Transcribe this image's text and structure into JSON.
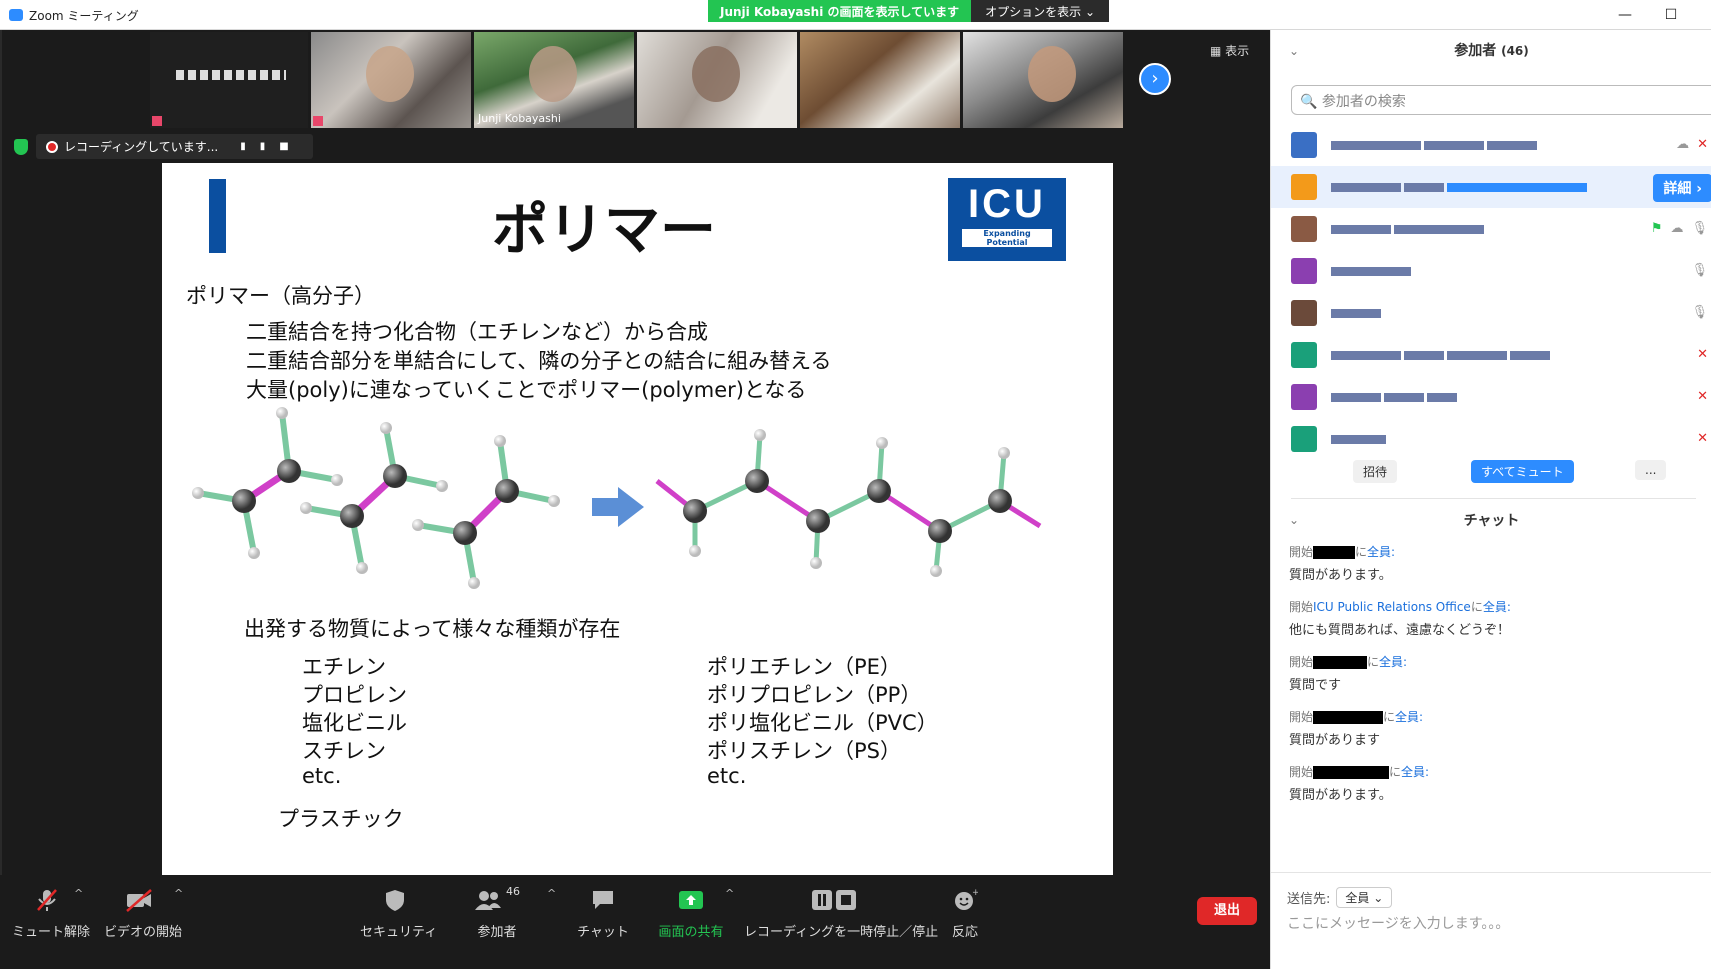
{
  "window": {
    "title": "Zoom ミーティング",
    "share_banner": "Junji  Kobayashi の画面を表示しています",
    "share_options": "オプションを表示 ⌄",
    "minimize": "—",
    "maximize": "☐"
  },
  "gallery": {
    "view_label": "表示",
    "named_participant": "Junji Kobayashi"
  },
  "recording": {
    "status": "レコーディングしています...",
    "pause_icon": "pause-icon",
    "stop_icon": "stop-icon"
  },
  "slide": {
    "title": "ポリマー",
    "logo_main": "ICU",
    "logo_sub": "Expanding Potential",
    "heading": "ポリマー（高分子）",
    "lines": [
      "二重結合を持つ化合物（エチレンなど）から合成",
      "二重結合部分を単結合にして、隣の分子との結合に組み替える",
      "大量(poly)に連なっていくことでポリマー(polymer)となる"
    ],
    "variety_heading": "出発する物質によって様々な種類が存在",
    "monomers": [
      "エチレン",
      "プロピレン",
      "塩化ビニル",
      "スチレン",
      "etc."
    ],
    "polymers": [
      "ポリエチレン（PE）",
      "ポリプロピレン（PP）",
      "ポリ塩化ビニル（PVC）",
      "ポリスチレン（PS）",
      "etc."
    ],
    "footer": "プラスチック"
  },
  "controls": {
    "unmute": "ミュート解除",
    "start_video": "ビデオの開始",
    "security": "セキュリティ",
    "participants": "参加者",
    "participants_count": "46",
    "chat": "チャット",
    "share": "画面の共有",
    "record": "レコーディングを一時停止／停止",
    "reactions": "反応",
    "leave": "退出"
  },
  "participants_panel": {
    "title": "参加者",
    "count": "(46)",
    "search_placeholder": "参加者の検索",
    "detail_button": "詳細 ›",
    "invite": "招待",
    "mute_all": "すべてミュート",
    "more": "..."
  },
  "chat_panel": {
    "title": "チャット",
    "messages": [
      {
        "prefix": "開始",
        "sender": "",
        "to_prefix": "に",
        "to": "全員:",
        "body": "質問があります。"
      },
      {
        "prefix": "開始",
        "sender": "ICU Public Relations Office",
        "to_prefix": "に",
        "to": "全員:",
        "body": "他にも質問あれば、遠慮なくどうぞ！"
      },
      {
        "prefix": "開始",
        "sender": "",
        "to_prefix": "に",
        "to": "全員:",
        "body": "質問です"
      },
      {
        "prefix": "開始",
        "sender": "",
        "to_prefix": "に",
        "to": "全員:",
        "body": "質問があります"
      },
      {
        "prefix": "開始",
        "sender": "",
        "to_prefix": "に",
        "to": "全員:",
        "body": "質問があります。"
      }
    ],
    "send_to_label": "送信先:",
    "send_to_value": "全員 ⌄",
    "input_placeholder": "ここにメッセージを入力します。。。"
  },
  "colors": {
    "accent": "#2d8cff",
    "share_green": "#23c552",
    "leave_red": "#e02828",
    "icu_blue": "#0b4fa0"
  }
}
